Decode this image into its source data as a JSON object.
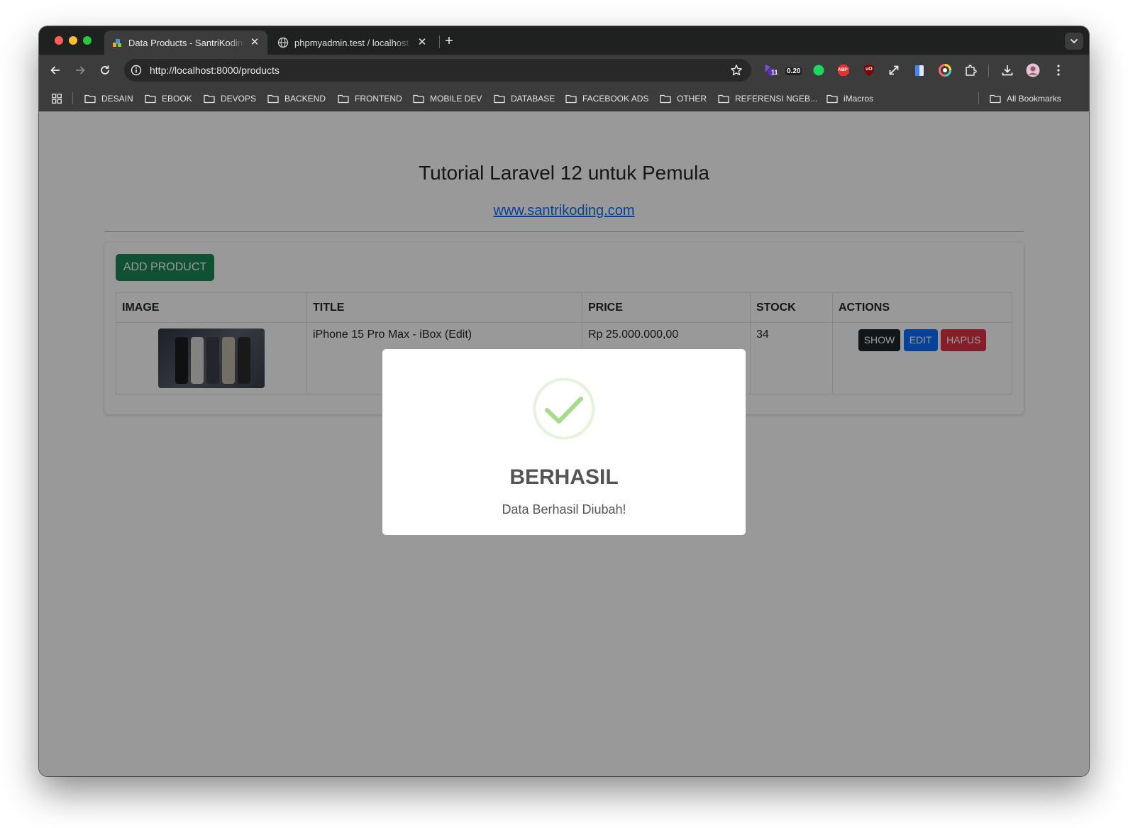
{
  "browser": {
    "tabs": [
      {
        "title": "Data Products - SantriKoding.com",
        "active": true
      },
      {
        "title": "phpmyadmin.test / localhost / laravel",
        "active": false
      }
    ],
    "url": "http://localhost:8000/products",
    "extensions": {
      "badge_count": "11",
      "badge_value": "0.20",
      "abp_label": "ABP",
      "ublock_label": "uO"
    },
    "bookmarks": [
      "DESAIN",
      "EBOOK",
      "DEVOPS",
      "BACKEND",
      "FRONTEND",
      "MOBILE DEV",
      "DATABASE",
      "FACEBOOK ADS",
      "OTHER",
      "REFERENSI NGEB...",
      "iMacros"
    ],
    "all_bookmarks": "All Bookmarks"
  },
  "page": {
    "title": "Tutorial Laravel 12 untuk Pemula",
    "link": "www.santrikoding.com",
    "add_button": "ADD PRODUCT",
    "table": {
      "headers": [
        "IMAGE",
        "TITLE",
        "PRICE",
        "STOCK",
        "ACTIONS"
      ],
      "rows": [
        {
          "title": "iPhone 15 Pro Max - iBox (Edit)",
          "price": "Rp 25.000.000,00",
          "stock": "34",
          "actions": [
            "SHOW",
            "EDIT",
            "HAPUS"
          ]
        }
      ]
    }
  },
  "modal": {
    "title": "BERHASIL",
    "text": "Data Berhasil Diubah!",
    "icon": "success-check-icon"
  },
  "colors": {
    "success": "#198754",
    "primary": "#0d6efd",
    "danger": "#dc3545",
    "dark": "#212529",
    "check": "#a5dc86"
  }
}
